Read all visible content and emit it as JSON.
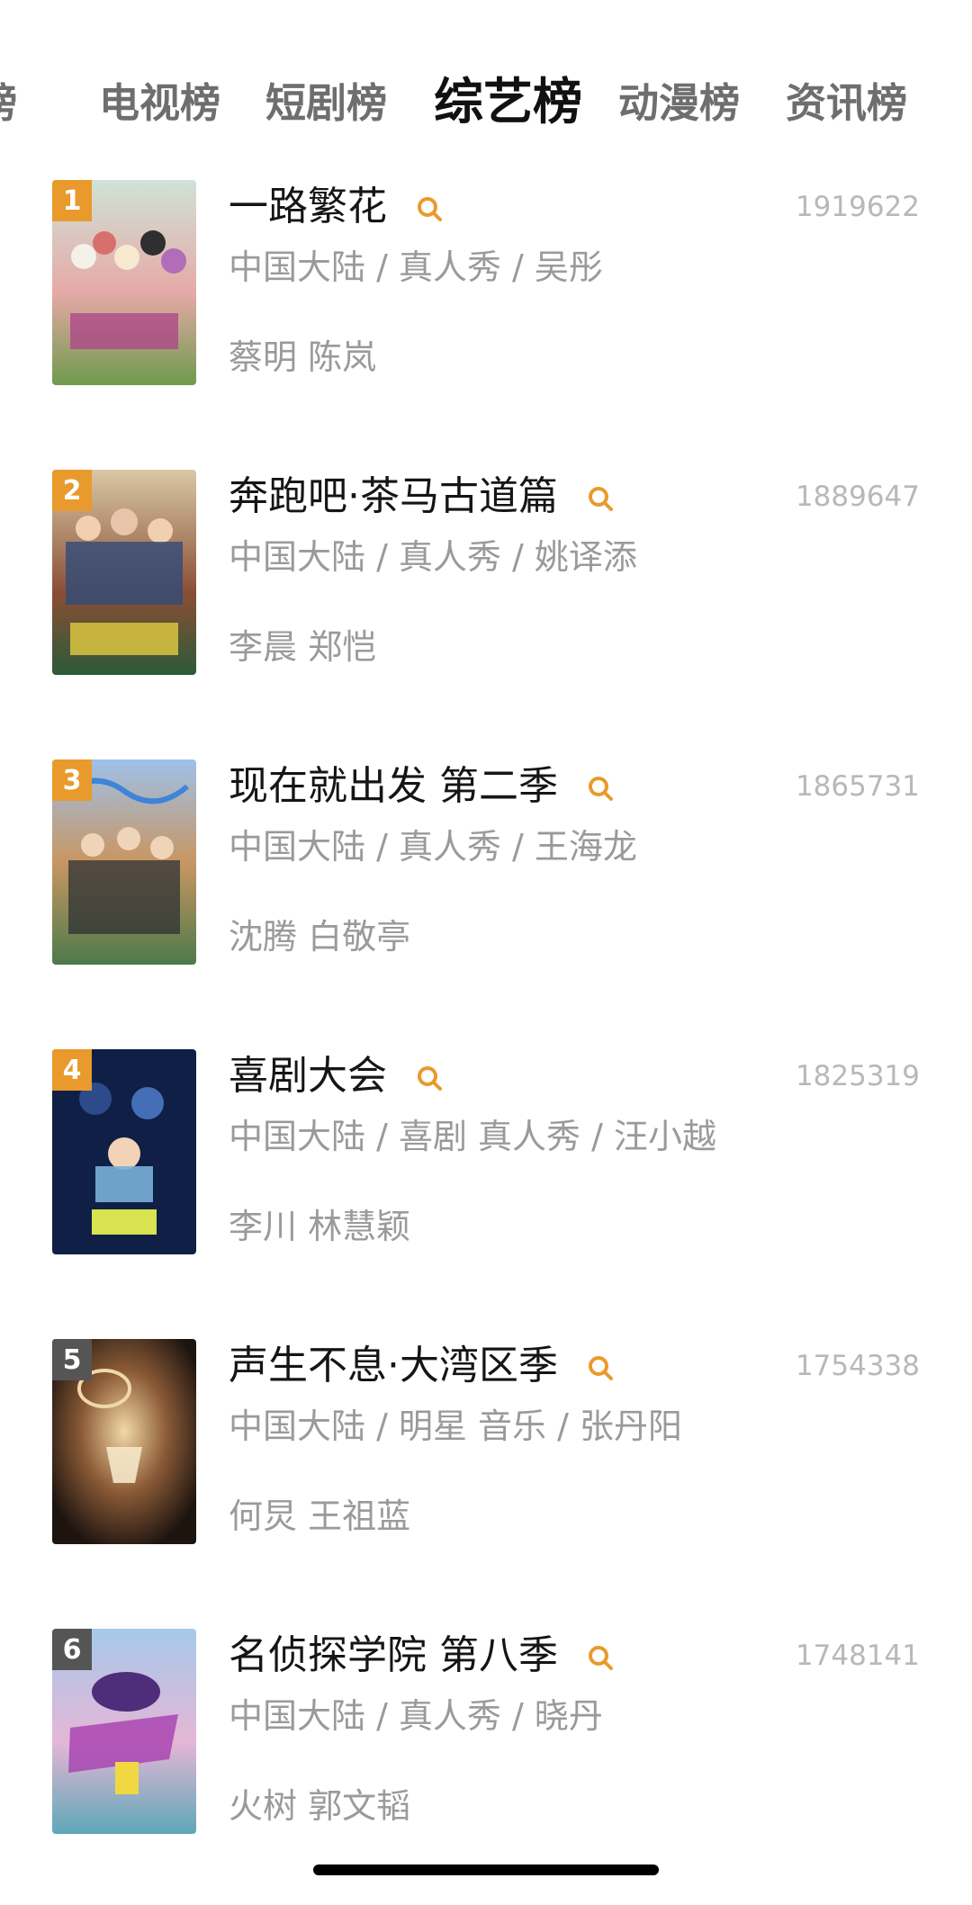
{
  "tabs": [
    {
      "label": "榜"
    },
    {
      "label": "电视榜"
    },
    {
      "label": "短剧榜"
    },
    {
      "label": "综艺榜"
    },
    {
      "label": "动漫榜"
    },
    {
      "label": "资讯榜"
    }
  ],
  "items": [
    {
      "rank": "1",
      "title": "一路繁花",
      "score": "1919622",
      "meta": "中国大陆 / 真人秀 / 吴彤",
      "cast": "蔡明 陈岚",
      "rank_color": "#e99a2c"
    },
    {
      "rank": "2",
      "title": "奔跑吧·茶马古道篇",
      "score": "1889647",
      "meta": "中国大陆 / 真人秀 / 姚译添",
      "cast": "李晨 郑恺",
      "rank_color": "#e99a2c"
    },
    {
      "rank": "3",
      "title": "现在就出发 第二季",
      "score": "1865731",
      "meta": "中国大陆 / 真人秀 / 王海龙",
      "cast": "沈腾 白敬亭",
      "rank_color": "#e99a2c"
    },
    {
      "rank": "4",
      "title": "喜剧大会",
      "score": "1825319",
      "meta": "中国大陆 / 喜剧 真人秀 / 汪小越",
      "cast": "李川 林慧颖",
      "rank_color": "#e99a2c"
    },
    {
      "rank": "5",
      "title": "声生不息·大湾区季",
      "score": "1754338",
      "meta": "中国大陆 / 明星 音乐 / 张丹阳",
      "cast": "何炅 王祖蓝",
      "rank_color": "#555555"
    },
    {
      "rank": "6",
      "title": "名侦探学院 第八季",
      "score": "1748141",
      "meta": "中国大陆 / 真人秀 / 晓丹",
      "cast": "火树 郭文韬",
      "rank_color": "#555555"
    }
  ],
  "search_icon_name": "search-icon",
  "accent_color": "#e99a2c"
}
